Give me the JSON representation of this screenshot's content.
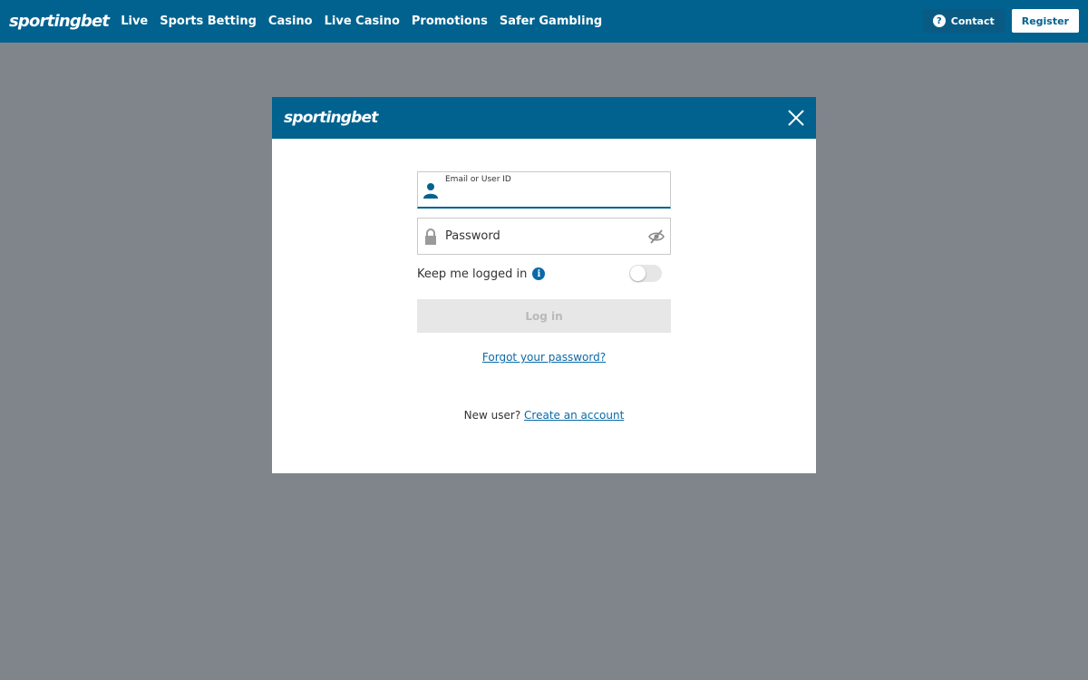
{
  "brand": {
    "name": "sportingbet",
    "accent": "#01628f"
  },
  "nav": {
    "items": [
      {
        "label": "Live"
      },
      {
        "label": "Sports Betting"
      },
      {
        "label": "Casino"
      },
      {
        "label": "Live Casino"
      },
      {
        "label": "Promotions"
      },
      {
        "label": "Safer Gambling"
      }
    ],
    "contact_label": "Contact",
    "register_label": "Register"
  },
  "modal": {
    "logo": "sportingbet",
    "email": {
      "label": "Email or User ID",
      "value": ""
    },
    "password": {
      "placeholder": "Password"
    },
    "keep_logged_in": {
      "label": "Keep me logged in",
      "enabled": false
    },
    "login_label": "Log in",
    "forgot_label": "Forgot your password?",
    "new_user_label": "New user?",
    "create_account_label": "Create an account"
  }
}
